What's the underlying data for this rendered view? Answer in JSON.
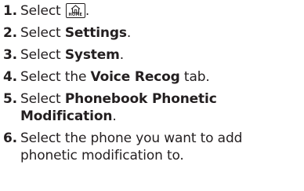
{
  "steps": [
    {
      "num": "1.",
      "pre": "Select ",
      "bold": "",
      "post": ".",
      "icon_label": "HOME",
      "icon": "home-icon"
    },
    {
      "num": "2.",
      "pre": "Select ",
      "bold": "Settings",
      "post": "."
    },
    {
      "num": "3.",
      "pre": "Select ",
      "bold": "System",
      "post": "."
    },
    {
      "num": "4.",
      "pre": "Select the ",
      "bold": "Voice Recog",
      "post": " tab."
    },
    {
      "num": "5.",
      "pre": "Select ",
      "bold": "Phonebook Phonetic Modification",
      "post": "."
    },
    {
      "num": "6.",
      "pre": "Select the phone you want to add phonetic modification to.",
      "bold": "",
      "post": ""
    }
  ]
}
